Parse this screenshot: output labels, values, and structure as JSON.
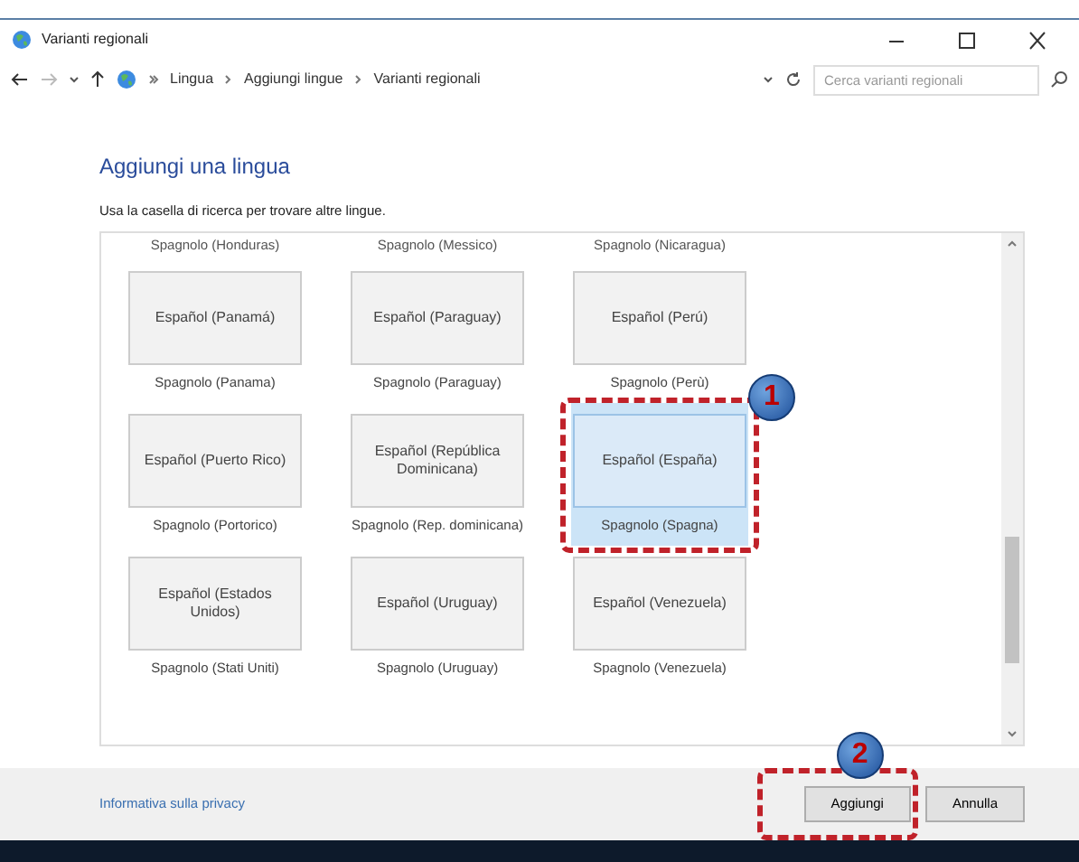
{
  "window": {
    "title": "Varianti regionali"
  },
  "address_bar": {
    "breadcrumbs": [
      "Lingua",
      "Aggiungi lingue",
      "Varianti regionali"
    ],
    "search_placeholder": "Cerca varianti regionali"
  },
  "heading": "Aggiungi una lingua",
  "instruction": "Usa la casella di ricerca per trovare altre lingue.",
  "partial_row": [
    "Spagnolo (Honduras)",
    "Spagnolo (Messico)",
    "Spagnolo (Nicaragua)"
  ],
  "languages": [
    {
      "native": "Español (Panamá)",
      "label": "Spagnolo (Panama)",
      "selected": false
    },
    {
      "native": "Español (Paraguay)",
      "label": "Spagnolo (Paraguay)",
      "selected": false
    },
    {
      "native": "Español (Perú)",
      "label": "Spagnolo (Perù)",
      "selected": false
    },
    {
      "native": "Español (Puerto Rico)",
      "label": "Spagnolo (Portorico)",
      "selected": false
    },
    {
      "native": "Español (República Dominicana)",
      "label": "Spagnolo (Rep. dominicana)",
      "selected": false
    },
    {
      "native": "Español (España)",
      "label": "Spagnolo (Spagna)",
      "selected": true,
      "callout": "1"
    },
    {
      "native": "Español (Estados Unidos)",
      "label": "Spagnolo (Stati Uniti)",
      "selected": false
    },
    {
      "native": "Español (Uruguay)",
      "label": "Spagnolo (Uruguay)",
      "selected": false
    },
    {
      "native": "Español (Venezuela)",
      "label": "Spagnolo (Venezuela)",
      "selected": false
    }
  ],
  "footer": {
    "privacy_link": "Informativa sulla privacy",
    "buttons": [
      {
        "label": "Aggiungi",
        "callout": "2"
      },
      {
        "label": "Annulla"
      }
    ]
  }
}
